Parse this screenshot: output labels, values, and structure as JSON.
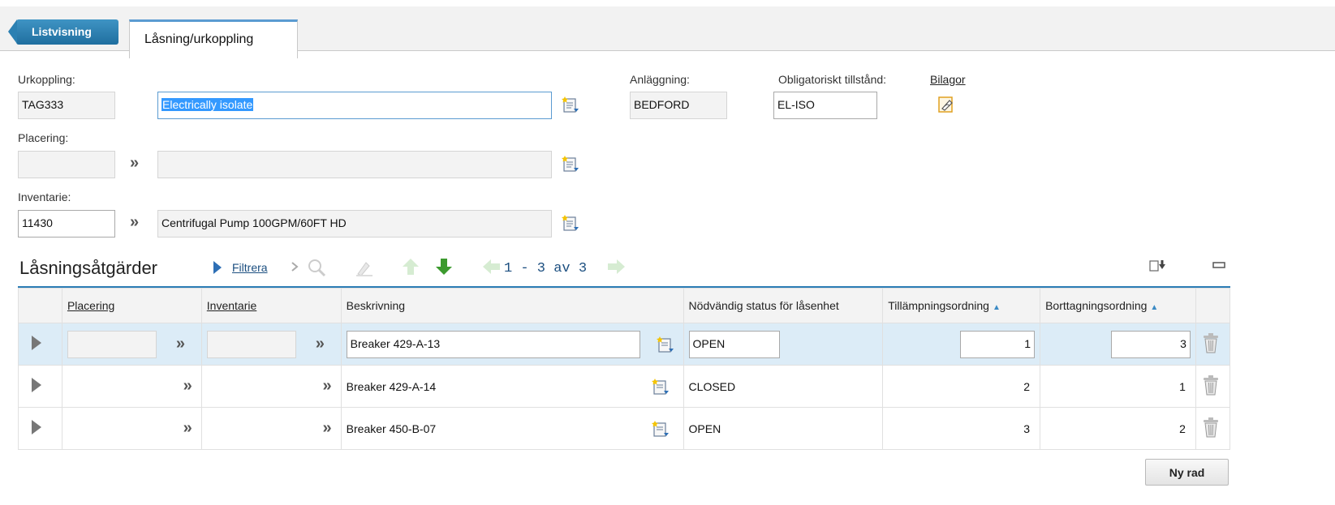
{
  "tabs": {
    "back_label": "Listvisning",
    "active_label": "Låsning/urkoppling"
  },
  "form": {
    "urkoppling_label": "Urkoppling:",
    "urkoppling_value": "TAG333",
    "description_value": "Electrically isolate",
    "anlaggning_label": "Anläggning:",
    "anlaggning_value": "BEDFORD",
    "tillstand_label": "Obligatoriskt tillstånd:",
    "tillstand_value": "EL-ISO",
    "bilagor_label": "Bilagor",
    "placering_label": "Placering:",
    "placering_value": "",
    "placering_desc": "",
    "inventarie_label": "Inventarie:",
    "inventarie_value": "11430",
    "inventarie_desc": "Centrifugal Pump 100GPM/60FT HD"
  },
  "section": {
    "title": "Låsningsåtgärder",
    "filter_label": "Filtrera",
    "pager_text": "1 - 3 av 3"
  },
  "table": {
    "headers": {
      "placering": "Placering",
      "inventarie": "Inventarie",
      "beskrivning": "Beskrivning",
      "status": "Nödvändig status för låsenhet",
      "tillampning": "Tillämpningsordning",
      "borttagning": "Borttagningsordning"
    },
    "rows": [
      {
        "beskrivning": "Breaker 429-A-13",
        "status": "OPEN",
        "tillampning": "1",
        "borttagning": "3"
      },
      {
        "beskrivning": "Breaker 429-A-14",
        "status": "CLOSED",
        "tillampning": "2",
        "borttagning": "1"
      },
      {
        "beskrivning": "Breaker 450-B-07",
        "status": "OPEN",
        "tillampning": "3",
        "borttagning": "2"
      }
    ]
  },
  "buttons": {
    "new_row": "Ny rad"
  },
  "icons": {
    "double_chevron": "»",
    "sort": "▲"
  },
  "colors": {
    "accent": "#2b7cb5",
    "highlight_row": "#dcecf7",
    "back_tab": "#2b80b2"
  }
}
